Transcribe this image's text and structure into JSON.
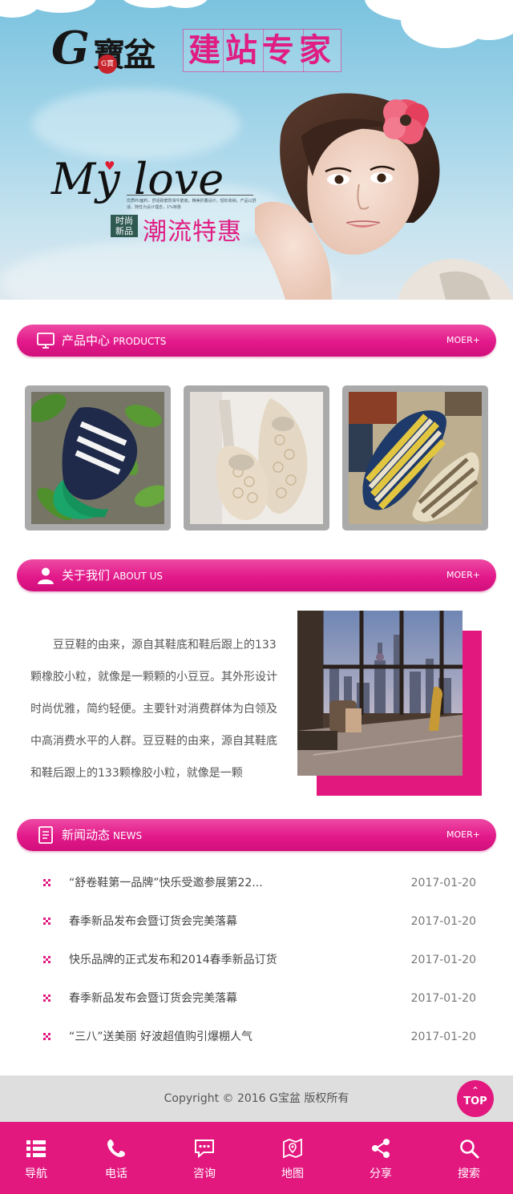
{
  "hero": {
    "logo_text": "寶盆",
    "logo_seal": "G寶",
    "site_title": "建站专家",
    "headline": "My love",
    "small_text": "优质PU面料，舒适耐磨防滑牛筋底，精美折叠设计，轻松收纳。产品以舒适、随性为设计理念，1%特惠",
    "badge_line1": "时尚",
    "badge_line2": "新品",
    "promo": "潮流特惠"
  },
  "sections": {
    "products": {
      "title": "产品中心",
      "en": "PRODUCTS",
      "more": "MOER+"
    },
    "about": {
      "title": "关于我们",
      "en": "ABOUT US",
      "more": "MOER+"
    },
    "news": {
      "title": "新闻动态",
      "en": "NEWS",
      "more": "MOER+"
    }
  },
  "about_text": "豆豆鞋的由来，源自其鞋底和鞋后跟上的133颗橡胶小粒，就像是一颗颗的小豆豆。其外形设计时尚优雅，简约轻便。主要针对消费群体为白领及中高消费水平的人群。豆豆鞋的由来，源自其鞋底和鞋后跟上的133颗橡胶小粒，就像是一颗",
  "news": [
    {
      "title": "“舒卷鞋第一品牌”快乐受邀参展第22...",
      "date": "2017-01-20"
    },
    {
      "title": "春季新品发布会暨订货会完美落幕",
      "date": "2017-01-20"
    },
    {
      "title": "快乐品牌的正式发布和2014春季新品订货",
      "date": "2017-01-20"
    },
    {
      "title": "春季新品发布会暨订货会完美落幕",
      "date": "2017-01-20"
    },
    {
      "title": "“三八”送美丽 好波超值购引爆棚人气",
      "date": "2017-01-20"
    }
  ],
  "footer": {
    "copyright": "Copyright © 2016 G宝盆 版权所有",
    "top_label": "TOP"
  },
  "bottom_nav": [
    {
      "label": "导航",
      "icon": "list-icon"
    },
    {
      "label": "电话",
      "icon": "phone-icon"
    },
    {
      "label": "咨询",
      "icon": "chat-icon"
    },
    {
      "label": "地图",
      "icon": "map-icon"
    },
    {
      "label": "分享",
      "icon": "share-icon"
    },
    {
      "label": "搜索",
      "icon": "search-icon"
    }
  ],
  "colors": {
    "accent": "#e3187f",
    "footer_bg": "#dedede",
    "product_frame": "#aaaaaa"
  }
}
